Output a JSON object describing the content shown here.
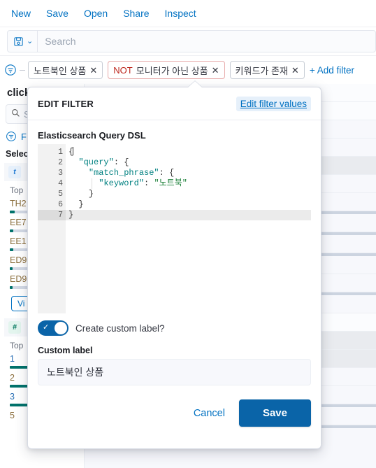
{
  "topmenu": {
    "items": [
      {
        "label": "New",
        "name": "menu-new"
      },
      {
        "label": "Save",
        "name": "menu-save"
      },
      {
        "label": "Open",
        "name": "menu-open"
      },
      {
        "label": "Share",
        "name": "menu-share"
      },
      {
        "label": "Inspect",
        "name": "menu-inspect"
      }
    ]
  },
  "querybar": {
    "saved_query_icon": "floppy-disk-icon",
    "chevron": "⌄",
    "search_placeholder": "Search",
    "search_value": ""
  },
  "filterbar": {
    "options_icon": "filter-options-icon",
    "pills": [
      {
        "label": "노트북인 상품",
        "negated": false,
        "close": "✕"
      },
      {
        "prefix": "NOT",
        "label": "모니터가 아닌 상품",
        "negated": true,
        "close": "✕"
      },
      {
        "label": "키워드가 존재",
        "negated": false,
        "close": "✕"
      }
    ],
    "add_filter": "+ Add filter"
  },
  "sidebar": {
    "heading": "click",
    "search_placeholder": "S",
    "filter_label": "F",
    "select_label": "Select",
    "fields": [
      {
        "tag": "t",
        "tag_kind": "t",
        "name": "",
        "top_label": "Top",
        "values": [
          {
            "text": "TH2",
            "color": "amber",
            "bar": 18
          },
          {
            "text": "EE7",
            "color": "rose",
            "bar": 14
          },
          {
            "text": "EE1",
            "color": "rose",
            "bar": 12
          },
          {
            "text": "ED9",
            "color": "rose",
            "bar": 11
          },
          {
            "text": "ED9",
            "color": "rose",
            "bar": 10
          }
        ],
        "viz_button": "Vi"
      },
      {
        "tag": "#",
        "tag_kind": "num",
        "name": "",
        "top_label": "Top",
        "values": [
          {
            "text": "1",
            "color": "blue",
            "bar": 34
          },
          {
            "text": "2",
            "color": "amber",
            "bar": 28
          },
          {
            "text": "3",
            "color": "blue",
            "bar": 38
          },
          {
            "text": "5",
            "color": "amber",
            "bar": 0
          }
        ]
      }
    ]
  },
  "popover": {
    "title": "EDIT FILTER",
    "edit_values_link": "Edit filter values",
    "dsl_label": "Elasticsearch Query DSL",
    "editor": {
      "lines": [
        {
          "n": "1",
          "fold": true,
          "tokens": [
            {
              "t": "{",
              "c": "p"
            }
          ],
          "cursor": true
        },
        {
          "n": "2",
          "fold": true,
          "tokens": [
            {
              "t": "  ",
              "c": "p"
            },
            {
              "t": "\"query\"",
              "c": "k"
            },
            {
              "t": ": {",
              "c": "p"
            }
          ]
        },
        {
          "n": "3",
          "fold": true,
          "tokens": [
            {
              "t": "    ",
              "c": "p"
            },
            {
              "t": "\"match_phrase\"",
              "c": "k"
            },
            {
              "t": ": {",
              "c": "p"
            }
          ]
        },
        {
          "n": "4",
          "fold": false,
          "tokens": [
            {
              "t": "      ",
              "c": "p"
            },
            {
              "t": "\"keyword\"",
              "c": "k"
            },
            {
              "t": ": ",
              "c": "p"
            },
            {
              "t": "\"노트북\"",
              "c": "s"
            }
          ]
        },
        {
          "n": "5",
          "fold": false,
          "tokens": [
            {
              "t": "    }",
              "c": "p"
            }
          ]
        },
        {
          "n": "6",
          "fold": false,
          "tokens": [
            {
              "t": "  }",
              "c": "p"
            }
          ]
        },
        {
          "n": "7",
          "fold": false,
          "tokens": [
            {
              "t": "}",
              "c": "p"
            }
          ],
          "active": true
        }
      ]
    },
    "toggle": {
      "label": "Create custom label?",
      "checked": true,
      "check_glyph": "✓"
    },
    "custom_label": {
      "label": "Custom label",
      "value": "노트북인 상품",
      "placeholder": ""
    },
    "cancel_label": "Cancel",
    "save_label": "Save"
  },
  "colors": {
    "accent": "#0071c2",
    "primary_button": "#0a64a8",
    "danger": "#bd271e",
    "teal": "#00726b",
    "string_green": "#1a7f37",
    "key_teal": "#008080"
  }
}
